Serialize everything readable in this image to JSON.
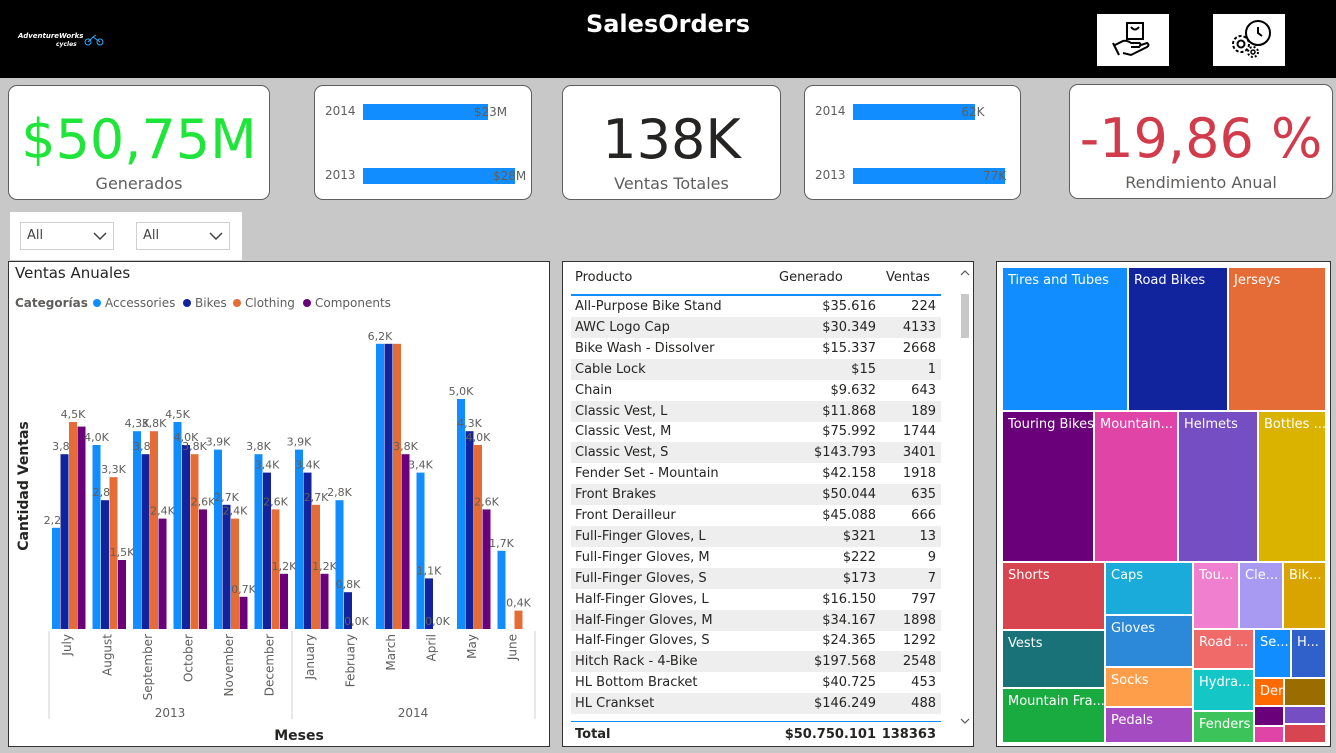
{
  "header": {
    "title": "SalesOrders",
    "logo_line1": "AdventureWorks",
    "logo_line2": "cycles",
    "buttons": [
      {
        "icon": "shopping-bag-hand-icon"
      },
      {
        "icon": "gears-settings-icon"
      }
    ]
  },
  "kpis": {
    "revenue": {
      "value": "$50,75M",
      "label": "Generados",
      "color": "#1fe43a"
    },
    "orders": {
      "value": "138K",
      "label": "Ventas Totales",
      "color": "#252423"
    },
    "performance": {
      "value": "-19,86 %",
      "label": "Rendimiento Anual",
      "color": "#d13b4b"
    }
  },
  "mini_revenue": [
    {
      "year": "2014",
      "label": "$23M",
      "value": 23
    },
    {
      "year": "2013",
      "label": "$28M",
      "value": 28
    }
  ],
  "mini_orders": [
    {
      "year": "2014",
      "label": "62K",
      "value": 62
    },
    {
      "year": "2013",
      "label": "77K",
      "value": 77
    }
  ],
  "slicers": [
    {
      "value": "All"
    },
    {
      "value": "All"
    }
  ],
  "chart_data": {
    "type": "bar",
    "title": "Ventas Anuales",
    "legend_title": "Categorías",
    "xlabel": "Meses",
    "ylabel": "Cantidad Ventas",
    "ylim": [
      0,
      6.5
    ],
    "legend_position": "top-left",
    "groups": [
      {
        "label": "2013",
        "months": [
          "July",
          "August",
          "September",
          "October",
          "November",
          "December"
        ]
      },
      {
        "label": "2014",
        "months": [
          "January",
          "February",
          "March",
          "April",
          "May",
          "June"
        ]
      }
    ],
    "categories": [
      "July",
      "August",
      "September",
      "October",
      "November",
      "December",
      "January",
      "February",
      "March",
      "April",
      "May",
      "June"
    ],
    "series": [
      {
        "name": "Accessories",
        "color": "#118dff",
        "values": [
          2.2,
          4.0,
          4.3,
          4.5,
          3.9,
          3.8,
          3.9,
          2.8,
          6.2,
          3.4,
          5.0,
          1.7
        ],
        "labels": [
          "2,2K",
          "4,0K",
          "4,3K",
          "4,5K",
          "3,9K",
          "3,8K",
          "3,9K",
          "2,8K",
          "6,2K",
          "3,4K",
          "5,0K",
          "1,7K"
        ]
      },
      {
        "name": "Bikes",
        "color": "#12239e",
        "values": [
          3.8,
          2.8,
          3.8,
          4.0,
          2.7,
          3.4,
          3.4,
          0.8,
          6.2,
          1.1,
          4.3,
          null
        ],
        "labels": [
          "3,8K",
          "2,8K",
          "3,8K",
          "4,0K",
          "2,7K",
          "3,4K",
          "3,4K",
          "0,8K",
          "",
          "1,1K",
          "4,3K",
          ""
        ]
      },
      {
        "name": "Clothing",
        "color": "#e66c37",
        "values": [
          4.5,
          3.3,
          4.3,
          3.8,
          2.4,
          2.6,
          2.7,
          0.0,
          6.2,
          0.0,
          4.0,
          0.4
        ],
        "labels": [
          "4,5K",
          "3,3K",
          "3,8K",
          "3,8K",
          "2,4K",
          "2,6K",
          "2,7K",
          "0,0K",
          "",
          "0,0K",
          "4,0K",
          "0,4K"
        ]
      },
      {
        "name": "Components",
        "color": "#6b007b",
        "values": [
          4.4,
          1.5,
          2.4,
          2.6,
          0.7,
          1.2,
          1.2,
          0.0,
          3.8,
          0.0,
          2.6,
          null
        ],
        "labels": [
          "",
          "1,5K",
          "2,4K",
          "2,6K",
          "0,7K",
          "1,2K",
          "1,2K",
          "",
          "3,8K",
          "",
          "2,6K",
          ""
        ]
      }
    ]
  },
  "table": {
    "headers": {
      "product": "Producto",
      "revenue": "Generado",
      "sales": "Ventas"
    },
    "rows": [
      {
        "product": "All-Purpose Bike Stand",
        "revenue": "$35.616",
        "sales": "224"
      },
      {
        "product": "AWC Logo Cap",
        "revenue": "$30.349",
        "sales": "4133"
      },
      {
        "product": "Bike Wash - Dissolver",
        "revenue": "$15.337",
        "sales": "2668"
      },
      {
        "product": "Cable Lock",
        "revenue": "$15",
        "sales": "1"
      },
      {
        "product": "Chain",
        "revenue": "$9.632",
        "sales": "643"
      },
      {
        "product": "Classic Vest, L",
        "revenue": "$11.868",
        "sales": "189"
      },
      {
        "product": "Classic Vest, M",
        "revenue": "$75.992",
        "sales": "1744"
      },
      {
        "product": "Classic Vest, S",
        "revenue": "$143.793",
        "sales": "3401"
      },
      {
        "product": "Fender Set - Mountain",
        "revenue": "$42.158",
        "sales": "1918"
      },
      {
        "product": "Front Brakes",
        "revenue": "$50.044",
        "sales": "635"
      },
      {
        "product": "Front Derailleur",
        "revenue": "$45.088",
        "sales": "666"
      },
      {
        "product": "Full-Finger Gloves, L",
        "revenue": "$321",
        "sales": "13"
      },
      {
        "product": "Full-Finger Gloves, M",
        "revenue": "$222",
        "sales": "9"
      },
      {
        "product": "Full-Finger Gloves, S",
        "revenue": "$173",
        "sales": "7"
      },
      {
        "product": "Half-Finger Gloves, L",
        "revenue": "$16.150",
        "sales": "797"
      },
      {
        "product": "Half-Finger Gloves, M",
        "revenue": "$34.167",
        "sales": "1898"
      },
      {
        "product": "Half-Finger Gloves, S",
        "revenue": "$24.365",
        "sales": "1292"
      },
      {
        "product": "Hitch Rack - 4-Bike",
        "revenue": "$197.568",
        "sales": "2548"
      },
      {
        "product": "HL Bottom Bracket",
        "revenue": "$40.725",
        "sales": "453"
      },
      {
        "product": "HL Crankset",
        "revenue": "$146.249",
        "sales": "488"
      }
    ],
    "total": {
      "label": "Total",
      "revenue": "$50.750.101",
      "sales": "138363"
    }
  },
  "treemap": [
    {
      "label": "Tires and Tubes",
      "color": "#118dff"
    },
    {
      "label": "Road Bikes",
      "color": "#12239e"
    },
    {
      "label": "Jerseys",
      "color": "#e66c37"
    },
    {
      "label": "Touring Bikes",
      "color": "#6b007b"
    },
    {
      "label": "Mountain...",
      "color": "#e044a7"
    },
    {
      "label": "Helmets",
      "color": "#744ec2"
    },
    {
      "label": "Bottles ...",
      "color": "#d9b300"
    },
    {
      "label": "Shorts",
      "color": "#d64550"
    },
    {
      "label": "Caps",
      "color": "#1aabdb"
    },
    {
      "label": "Tou...",
      "color": "#f07fd0"
    },
    {
      "label": "Cle...",
      "color": "#a89af2"
    },
    {
      "label": "Bik...",
      "color": "#d9a300"
    },
    {
      "label": "Vests",
      "color": "#197278"
    },
    {
      "label": "Gloves",
      "color": "#2c88d9"
    },
    {
      "label": "Road ...",
      "color": "#f06a6a"
    },
    {
      "label": "Se...",
      "color": "#118dff"
    },
    {
      "label": "H...",
      "color": "#3060c9"
    },
    {
      "label": "Socks",
      "color": "#ff9e4a"
    },
    {
      "label": "Hydra...",
      "color": "#15c6c6"
    },
    {
      "label": "Der...",
      "color": "#ff6a00"
    },
    {
      "label": "Mountain Fra...",
      "color": "#1aab40"
    },
    {
      "label": "Pedals",
      "color": "#a44bc2"
    },
    {
      "label": "Fenders",
      "color": "#3cc45a"
    }
  ]
}
